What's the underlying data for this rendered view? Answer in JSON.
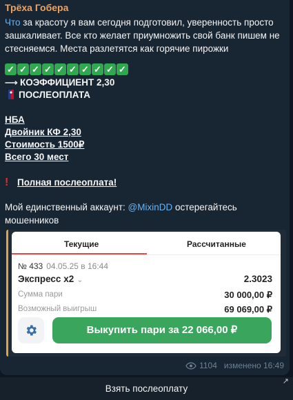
{
  "sender": "Трёха Гобера",
  "intro": {
    "link_word": "Что",
    "rest": " за красоту я вам сегодня подготовил, уверенность просто зашкаливает. Все кто желает приумножить свой банк пишем не стесняемся. Места разлетятся как горячие пирожки"
  },
  "checkmarks": [
    "✓",
    "✓",
    "✓",
    "✓",
    "✓",
    "✓",
    "✓",
    "✓",
    "✓",
    "✓"
  ],
  "coef_line": "КОЭФФИЦИЕНТ 2,30",
  "postpay_line": "ПОСЛЕОПЛАТА",
  "league": "НБА",
  "double": "Двойник КФ 2,30",
  "price": "Стоимость 1500₽",
  "seats": "Всего 30 мест",
  "full_postpay": "Полная послеоплата!",
  "account": {
    "prefix": "Мой единственный аккаунт: ",
    "handle": "@MixinDD",
    "suffix": " остерегайтесь мошенников"
  },
  "bet_card": {
    "tabs": [
      "Текущие",
      "Рассчитанные"
    ],
    "number": "№ 433",
    "date": "04.05.25 в 16:44",
    "type": "Экспресс x2",
    "coef": "2.3023",
    "sum_label": "Сумма пари",
    "sum_value": "30 000,00 ₽",
    "win_label": "Возможный выигрыш",
    "win_value": "69 069,00 ₽",
    "buyout_button": "Выкупить пари за 22 066,00 ₽"
  },
  "views": "1104",
  "edited": "изменено 16:49",
  "bottom_button": "Взять послеоплату",
  "colors": {
    "bg": "#0e1621",
    "bubble": "#182533",
    "sender": "#f0a35e",
    "link": "#6ab3f3",
    "accent_green": "#3aa55c",
    "tab_red": "#e24747"
  }
}
